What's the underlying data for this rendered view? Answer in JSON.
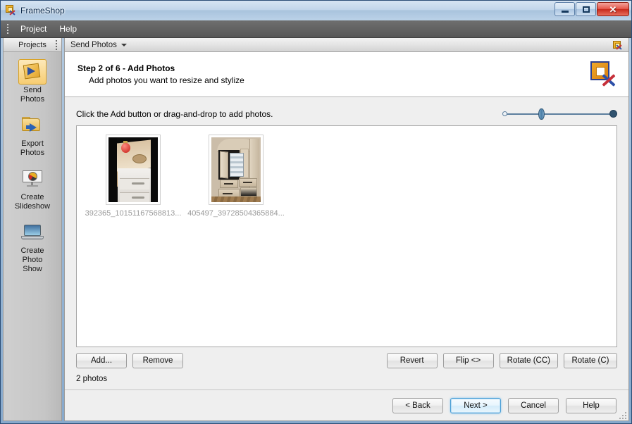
{
  "window": {
    "title": "FrameShop",
    "app_icon": "frameshop-app-icon",
    "caption": {
      "minimize": "minimize-icon",
      "maximize": "maximize-icon",
      "close": "✕"
    }
  },
  "menubar": {
    "grip": "menu-grip-icon",
    "items": [
      {
        "label": "Project"
      },
      {
        "label": "Help"
      }
    ]
  },
  "sidebar": {
    "header": {
      "label": "Projects",
      "grip": "panel-grip-icon"
    },
    "items": [
      {
        "label": "Send\nPhotos",
        "line1": "Send",
        "line2": "Photos",
        "icon": "send-photos-icon",
        "selected": true
      },
      {
        "label": "Export Photos",
        "line1": "Export",
        "line2": "Photos",
        "icon": "export-photos-icon",
        "selected": false
      },
      {
        "label": "Create Slideshow",
        "line1": "Create",
        "line2": "Slideshow",
        "icon": "create-slideshow-icon",
        "selected": false
      },
      {
        "label": "Create Photo Show",
        "line1": "Create",
        "line2": "Photo",
        "line3": "Show",
        "icon": "create-photo-show-icon",
        "selected": false
      }
    ]
  },
  "content": {
    "tab": {
      "label": "Send Photos",
      "caret": "chevron-down-icon",
      "corner_icon": "frameshop-small-icon"
    },
    "step": {
      "title": "Step 2 of 6 - Add Photos",
      "subtitle": "Add photos you want to resize and stylize",
      "icon": "frame-and-tools-icon"
    },
    "hint": "Click the Add button or drag-and-drop to add photos.",
    "zoom_slider": {
      "name": "thumbnail-size-slider",
      "min_icon": "small-thumbnail-icon",
      "max_icon": "large-thumbnail-icon",
      "value_percent": 31
    },
    "photos": [
      {
        "filename": "392365_10151167568813...",
        "art": "photo1"
      },
      {
        "filename": "405497_39728504365884...",
        "art": "photo2"
      }
    ],
    "photo_count": "2 photos",
    "actions_left": [
      {
        "label": "Add..."
      },
      {
        "label": "Remove"
      }
    ],
    "actions_right": [
      {
        "label": "Revert"
      },
      {
        "label": "Flip <>"
      },
      {
        "label": "Rotate (CC)"
      },
      {
        "label": "Rotate (C)"
      }
    ]
  },
  "footer": {
    "buttons": [
      {
        "label": "< Back",
        "default": false
      },
      {
        "label": "Next >",
        "default": true
      },
      {
        "label": "Cancel",
        "default": false
      },
      {
        "label": "Help",
        "default": false
      }
    ],
    "grip": "resize-grip-icon"
  },
  "colors": {
    "accent_blue": "#4b9fd6",
    "title_blue": "#0d2c4e",
    "close_red": "#c72a1c",
    "selected_orange": "#f7cd72",
    "filename_gray": "#9a9a9a"
  }
}
